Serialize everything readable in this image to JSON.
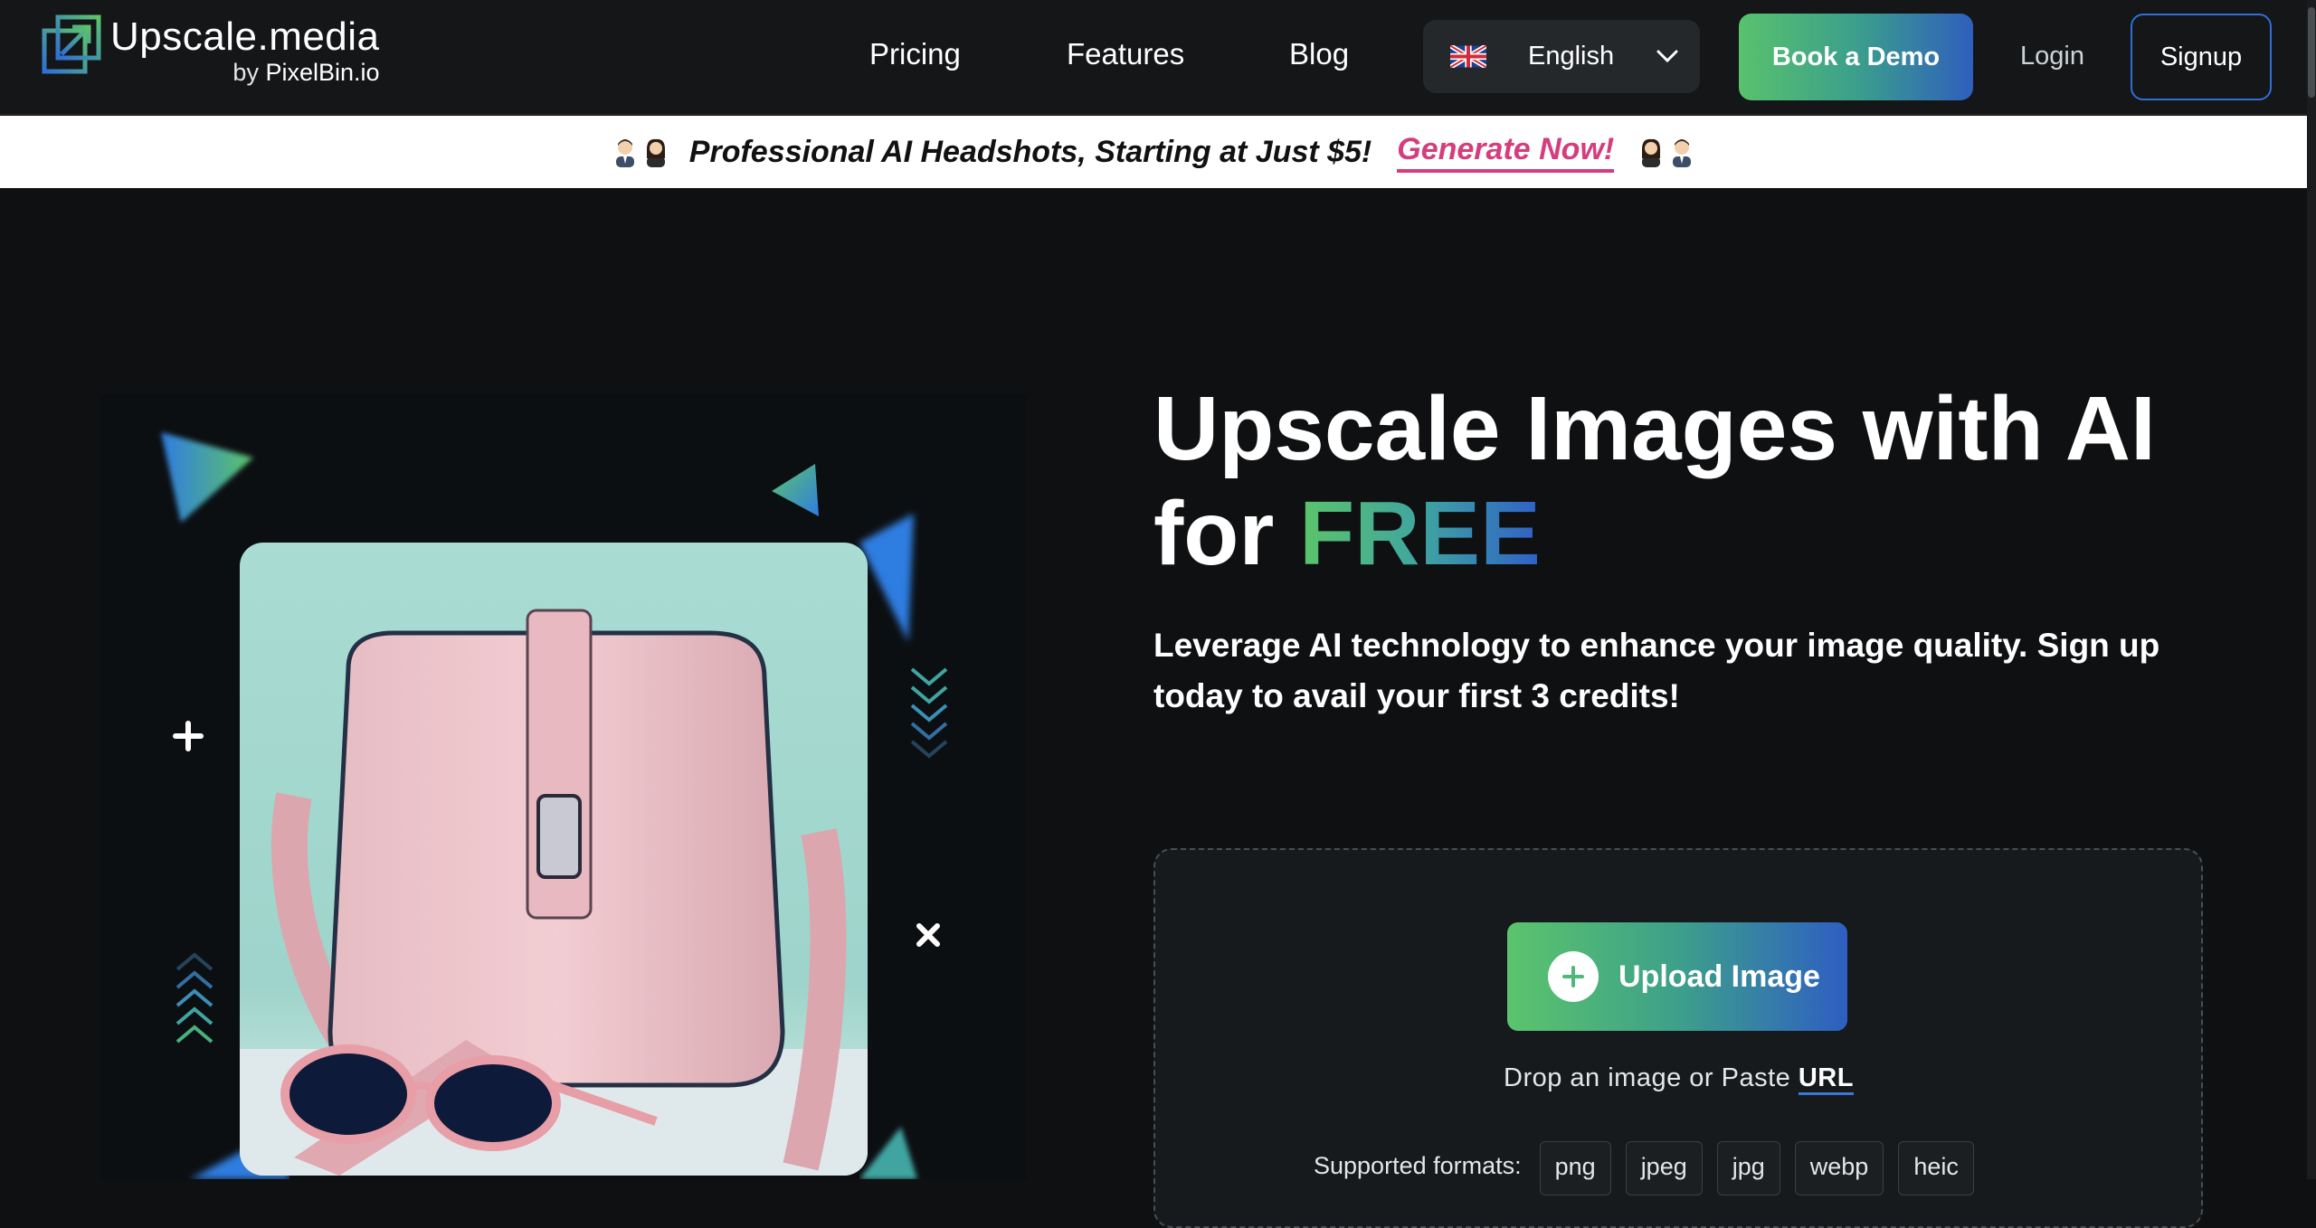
{
  "brand": {
    "name": "Upscale.media",
    "by_prefix": "by",
    "by_name": "PixelBin.io"
  },
  "nav": {
    "links": [
      "Pricing",
      "Features",
      "Blog"
    ],
    "language": "English",
    "demo_label": "Book a Demo",
    "login_label": "Login",
    "signup_label": "Signup"
  },
  "banner": {
    "text": "Professional AI Headshots, Starting at Just $5!",
    "link": "Generate Now!"
  },
  "hero": {
    "title_line1": "Upscale Images with AI",
    "title_for": "for",
    "title_free": "FREE",
    "subtitle": "Leverage AI technology to enhance your image quality. Sign up today to avail your first 3 credits!"
  },
  "upload": {
    "button_label": "Upload Image",
    "drop_text": "Drop an image or Paste",
    "url_label": "URL",
    "formats_label": "Supported formats:",
    "formats": [
      "png",
      "jpeg",
      "jpg",
      "webp",
      "heic"
    ]
  },
  "colors": {
    "accent_green": "#58c26c",
    "accent_blue": "#2f5fbd",
    "banner_link": "#d43d7e",
    "background": "#0e1012"
  }
}
